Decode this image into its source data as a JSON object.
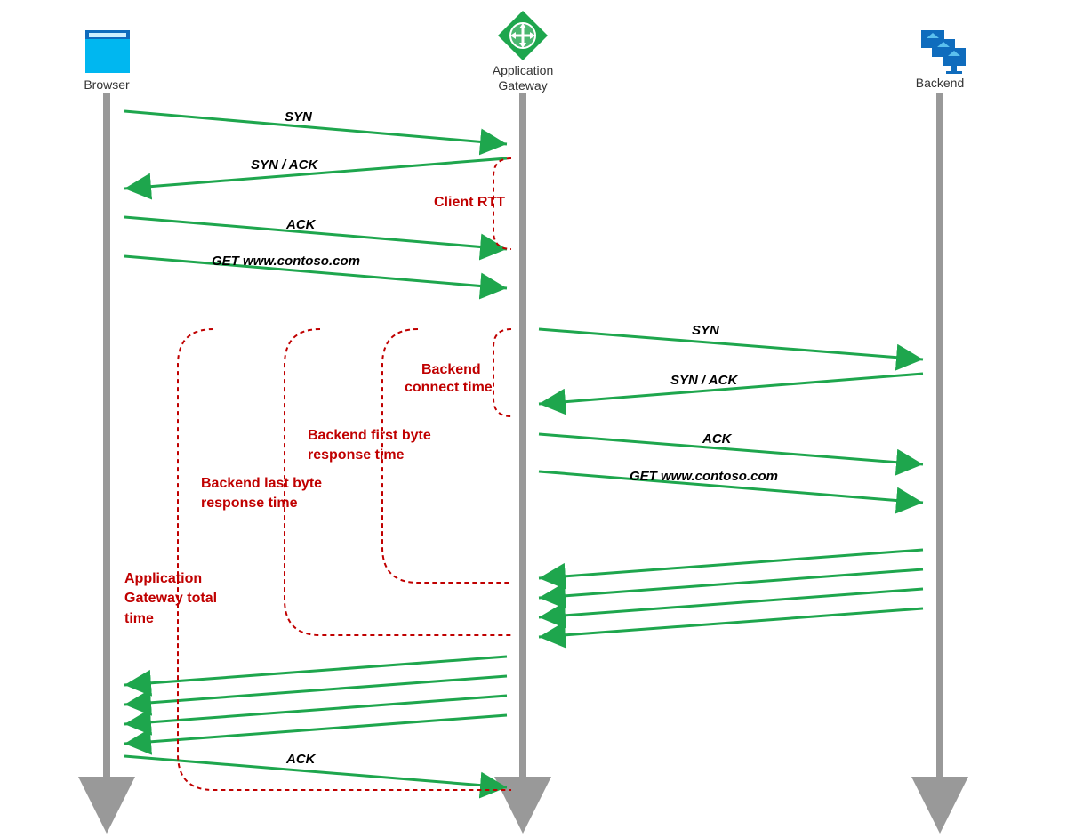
{
  "actors": {
    "browser": "Browser",
    "gateway_l1": "Application",
    "gateway_l2": "Gateway",
    "backend": "Backend"
  },
  "messages": {
    "m1": "SYN",
    "m2": "SYN / ACK",
    "m3": "ACK",
    "m4": "GET www.contoso.com",
    "m5": "SYN",
    "m6": "SYN / ACK",
    "m7": "ACK",
    "m8": "GET www.contoso.com",
    "m9": "ACK"
  },
  "metrics": {
    "client_rtt": "Client RTT",
    "backend_connect": "Backend\nconnect time",
    "backend_first_byte": "Backend first byte\nresponse time",
    "backend_last_byte": "Backend last byte\nresponse time",
    "agw_total": "Application\nGateway total\ntime"
  },
  "colors": {
    "arrow": "#1EA64D",
    "metric": "#C00000",
    "lifeline": "#999999",
    "browser_icon": "#00B7F0",
    "browser_icon_top": "#0F6CBD",
    "gateway_icon": "#1EA64D",
    "backend_icon": "#0F6CBD"
  }
}
